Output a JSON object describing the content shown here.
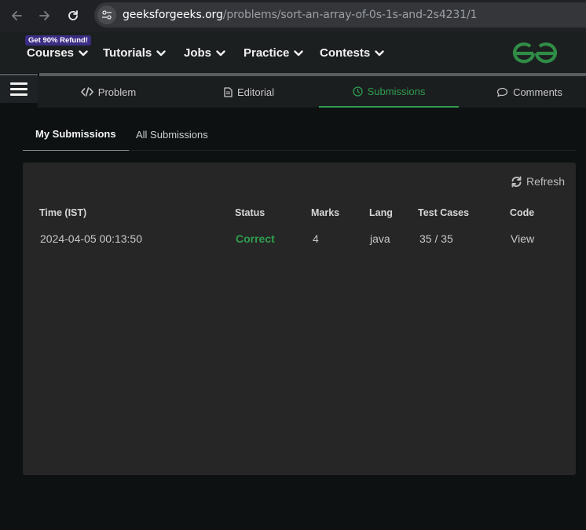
{
  "browser": {
    "url_host": "geeksforgeeks.org",
    "url_path": "/problems/sort-an-array-of-0s-1s-and-2s4231/1"
  },
  "header": {
    "refund_badge": "Get 90% Refund!",
    "menu": [
      "Courses",
      "Tutorials",
      "Jobs",
      "Practice",
      "Contests"
    ],
    "logo_color": "#2f8d46"
  },
  "problem_tabs": [
    {
      "label": "Problem",
      "icon": "code-icon"
    },
    {
      "label": "Editorial",
      "icon": "document-icon"
    },
    {
      "label": "Submissions",
      "icon": "clock-icon",
      "active": true
    },
    {
      "label": "Comments",
      "icon": "comment-icon"
    }
  ],
  "submission_tabs": {
    "mine": "My Submissions",
    "all": "All Submissions"
  },
  "panel": {
    "refresh_label": "Refresh",
    "columns": [
      "Time (IST)",
      "Status",
      "Marks",
      "Lang",
      "Test Cases",
      "Code"
    ],
    "rows": [
      {
        "time": "2024-04-05 00:13:50",
        "status": "Correct",
        "marks": "4",
        "lang": "java",
        "test_cases": "35 / 35",
        "code": "View"
      }
    ]
  },
  "colors": {
    "accent_green": "#2f9e4f",
    "badge_purple": "#3b2d84"
  }
}
